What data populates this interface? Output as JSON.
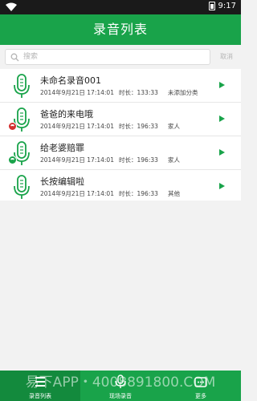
{
  "status_bar": {
    "time": "9:17"
  },
  "header": {
    "title": "录音列表"
  },
  "search": {
    "placeholder": "搜索",
    "cancel_label": "取消"
  },
  "recordings": [
    {
      "name": "未命名录音001",
      "date": "2014年9月21日 17:14:01",
      "duration": "时长：133:33",
      "category": "未添加分类",
      "badge": "none"
    },
    {
      "name": "爸爸的来电哦",
      "date": "2014年9月21日 17:14:01",
      "duration": "时长：196:33",
      "category": "家人",
      "badge": "call-red"
    },
    {
      "name": "给老婆赔罪",
      "date": "2014年9月21日 17:14:01",
      "duration": "时长：196:33",
      "category": "家人",
      "badge": "call-green"
    },
    {
      "name": "长按编辑啦",
      "date": "2014年9月21日 17:14:01",
      "duration": "时长：196:33",
      "category": "其他",
      "badge": "none"
    }
  ],
  "tabs": [
    {
      "label": "录音列表",
      "icon": "list-icon"
    },
    {
      "label": "现场录音",
      "icon": "mic-icon"
    },
    {
      "label": "更多",
      "icon": "more-icon"
    }
  ],
  "watermark": "易下APP・4008891800.COM",
  "colors": {
    "primary": "#19a34a",
    "primary_dark": "#138a3d",
    "missed_call": "#d32f2f"
  }
}
